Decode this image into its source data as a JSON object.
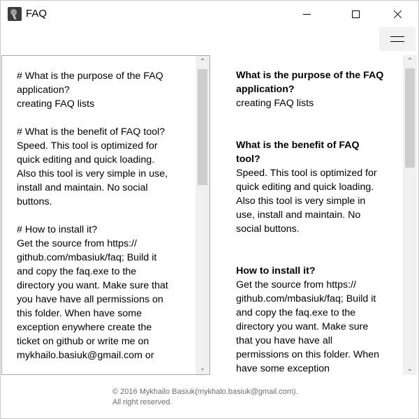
{
  "window": {
    "title": "FAQ"
  },
  "titlebar": {
    "icons": [
      "app-icon",
      "minimize-icon",
      "maximize-icon",
      "close-icon",
      "hamburger-menu-icon"
    ]
  },
  "editor": {
    "text": "# What is the purpose of the FAQ\napplication?\ncreating FAQ lists\n\n# What is the benefit of FAQ tool?\nSpeed. This tool is optimized for\nquick editing and quick loading.\nAlso this tool is very simple in use,\ninstall and maintain. No social\nbuttons.\n\n# How to install it?\nGet the source from https://\ngithub.com/mbasiuk/faq; Build it\nand copy the faq.exe to the\ndirectory you want. Make sure that\nyou have have all permissions on\nthis folder. When have some\nexception enywhere create the\nticket on github or write me on\nmykhailo.basiuk@gmail.com or",
    "scroll_position": 0.0
  },
  "preview": {
    "sections": [
      {
        "heading": "What is the purpose of the FAQ application?",
        "body": "creating FAQ lists"
      },
      {
        "heading": "What is the benefit of FAQ tool?",
        "body": "Speed. This tool is optimized for quick editing and quick loading. Also this tool is very simple in use, install and maintain. No social buttons."
      },
      {
        "heading": "How to install it?",
        "body": "Get the source from https:// github.com/mbasiuk/faq; Build it and copy the faq.exe to the directory you want. Make sure that you have have all permissions on this folder. When have some exception"
      }
    ],
    "scroll_position": 0.0
  },
  "footer": {
    "line1": "© 2016 Mykhailo Basiuk(mykhalo.basiuk@gmail.com).",
    "line2": "All right reserved."
  }
}
